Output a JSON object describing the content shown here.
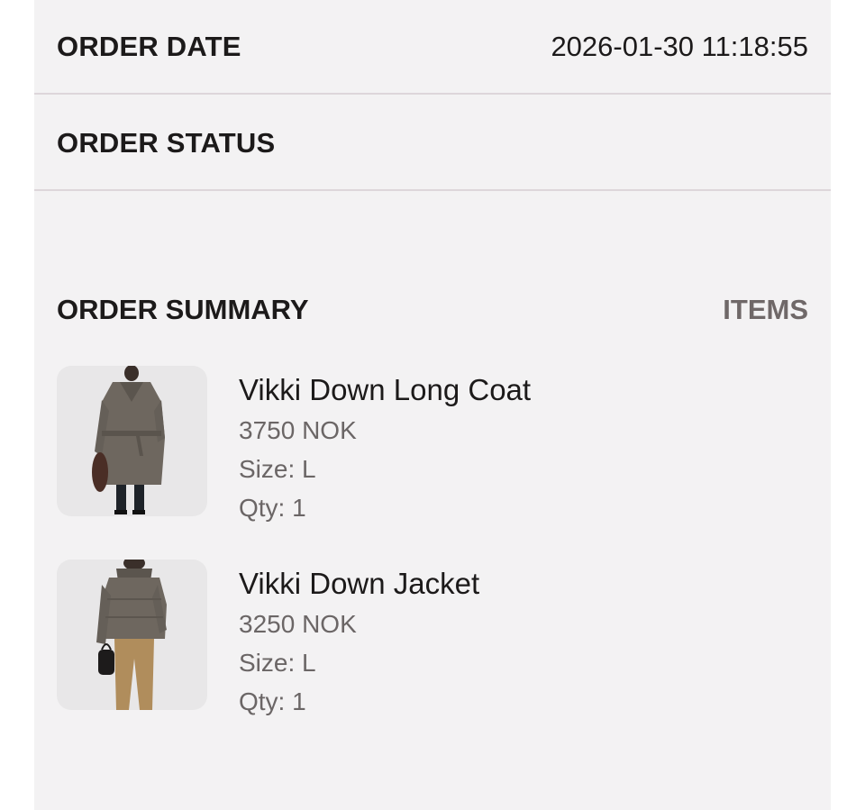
{
  "order_date": {
    "label": "ORDER DATE",
    "value": "2026-01-30 11:18:55"
  },
  "order_status": {
    "label": "ORDER STATUS"
  },
  "summary": {
    "title": "ORDER SUMMARY",
    "items_link": "ITEMS"
  },
  "items": [
    {
      "name": "Vikki Down Long Coat",
      "price": "3750 NOK",
      "size": "Size: L",
      "qty": "Qty: 1",
      "image": "long-coat-product-image"
    },
    {
      "name": "Vikki Down Jacket",
      "price": "3250 NOK",
      "size": "Size: L",
      "qty": "Qty: 1",
      "image": "down-jacket-product-image"
    }
  ],
  "colors": {
    "panel_background": "#f3f2f3",
    "divider": "#ddd6da",
    "text_primary": "#1c1a1a",
    "text_secondary": "#6b6666",
    "coat": "#6e675f",
    "trousers": "#b08d5c"
  }
}
